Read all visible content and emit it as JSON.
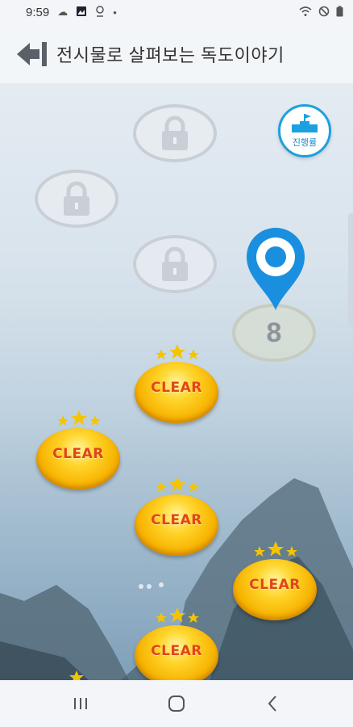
{
  "status_bar": {
    "time": "9:59",
    "icons": [
      "cloud-icon",
      "gallery-icon",
      "location-icon",
      "dot-icon",
      "wifi-icon",
      "do-not-disturb-icon",
      "battery-icon"
    ]
  },
  "header": {
    "title": "전시물로 살펴보는 독도이야기",
    "back_icon": "back-arrow-icon"
  },
  "progress_button": {
    "label": "진행률",
    "icon": "flag-podium-icon"
  },
  "current_stage": {
    "number": "8",
    "icon": "map-pin-icon"
  },
  "locked_stages": 3,
  "cleared_stages": [
    {
      "label": "CLEAR",
      "stars": 3
    },
    {
      "label": "CLEAR",
      "stars": 3
    },
    {
      "label": "CLEAR",
      "stars": 3
    },
    {
      "label": "CLEAR",
      "stars": 3
    },
    {
      "label": "CLEAR",
      "stars": 3
    }
  ],
  "nav_bar": [
    "recent-apps-icon",
    "home-icon",
    "back-icon"
  ],
  "colors": {
    "accent": "#1da0e0",
    "clear_text": "#e0451a",
    "coin": "#ffd42a",
    "star": "#f5c400"
  }
}
